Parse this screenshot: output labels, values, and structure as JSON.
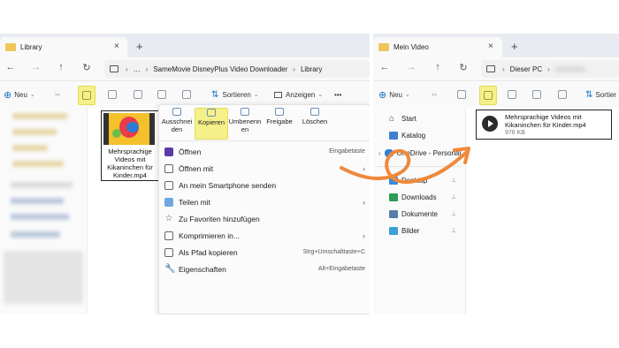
{
  "left_window": {
    "tab_title": "Library",
    "close_icon": "×",
    "new_tab_icon": "+",
    "nav": {
      "back": "←",
      "forward": "→",
      "up": "↑",
      "refresh": "↻"
    },
    "breadcrumb": [
      "…",
      "SameMovie DisneyPlus Video Downloader",
      "Library"
    ],
    "new_label": "Neu",
    "sort_label": "Sortieren",
    "view_label": "Anzeigen",
    "more_label": "•••",
    "file": {
      "name": "Mehrsprachige Videos mit Kikaninchen für Kinder.mp4"
    }
  },
  "context_menu": {
    "top_actions": [
      {
        "label": "Ausschneiden"
      },
      {
        "label": "Kopieren",
        "highlight": true
      },
      {
        "label": "Umbenennen"
      },
      {
        "label": "Freigabe"
      },
      {
        "label": "Löschen"
      }
    ],
    "items": [
      {
        "label": "Öffnen",
        "shortcut": "Eingabetaste",
        "arrow": ""
      },
      {
        "label": "Öffnen mit",
        "shortcut": "",
        "arrow": "›"
      },
      {
        "label": "An mein Smartphone senden",
        "shortcut": "",
        "arrow": ""
      },
      {
        "label": "Teilen mit",
        "shortcut": "",
        "arrow": "›"
      },
      {
        "label": "Zu Favoriten hinzufügen",
        "shortcut": "",
        "arrow": ""
      },
      {
        "label": "Komprimieren in...",
        "shortcut": "",
        "arrow": "›"
      },
      {
        "label": "Als Pfad kopieren",
        "shortcut": "Strg+Umschalttaste+C",
        "arrow": ""
      },
      {
        "label": "Eigenschaften",
        "shortcut": "Alt+Eingabetaste",
        "arrow": ""
      }
    ]
  },
  "right_window": {
    "tab_title": "Mein Video",
    "close_icon": "×",
    "new_tab_icon": "+",
    "breadcrumb": [
      "›",
      "Dieser PC",
      "›"
    ],
    "new_label": "Neu",
    "sort_label": "Sortier",
    "sidebar": [
      {
        "label": "Start",
        "pin": ""
      },
      {
        "label": "Katalog",
        "pin": ""
      },
      {
        "label": "OneDrive - Personal",
        "pin": ""
      },
      {
        "label": "Desktop",
        "pin": "📌"
      },
      {
        "label": "Downloads",
        "pin": "📌"
      },
      {
        "label": "Dokumente",
        "pin": "📌"
      },
      {
        "label": "Bilder",
        "pin": "📌"
      }
    ],
    "file": {
      "name": "Mehrsprachige Videos mit Kikaninchen für Kinder.mp4",
      "size": "976 KB"
    }
  },
  "colors": {
    "highlight": "#f5f08a",
    "arrow": "#f0883a",
    "tab_bg": "#e8ecf2"
  }
}
